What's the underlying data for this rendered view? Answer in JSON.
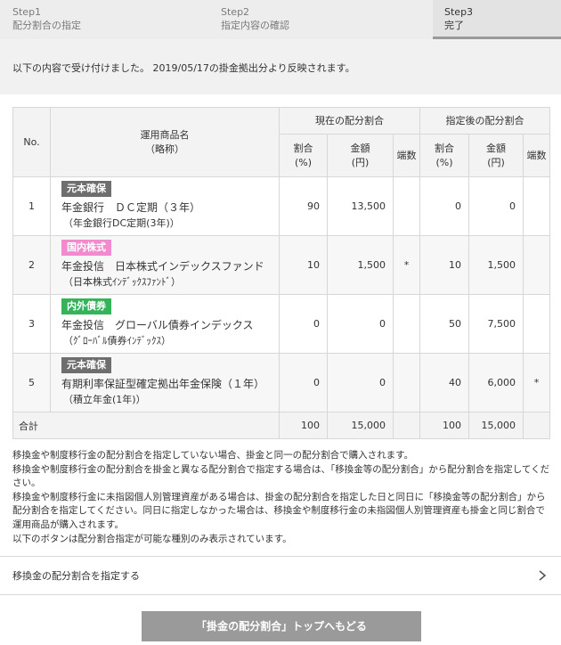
{
  "steps": [
    {
      "num": "Step1",
      "label": "配分割合の指定"
    },
    {
      "num": "Step2",
      "label": "指定内容の確認"
    },
    {
      "num": "Step3",
      "label": "完了"
    }
  ],
  "message": "以下の内容で受け付けました。 2019/05/17の掛金拠出分より反映されます。",
  "table": {
    "headers": {
      "no": "No.",
      "product_line1": "運用商品名",
      "product_line2": "（略称）",
      "current": "現在の配分割合",
      "after": "指定後の配分割合",
      "ratio_line1": "割合",
      "ratio_line2": "(%)",
      "amount_line1": "金額",
      "amount_line2": "(円)",
      "fraction": "端数"
    },
    "rows": [
      {
        "no": "1",
        "badge": "元本確保",
        "badge_color": "#6e6e6e",
        "name": "年金銀行　ＤＣ定期（３年）",
        "abbr": "（年金銀行DC定期(3年)）",
        "cur_ratio": "90",
        "cur_amount": "13,500",
        "cur_frac": "",
        "new_ratio": "0",
        "new_amount": "0",
        "new_frac": ""
      },
      {
        "no": "2",
        "badge": "国内株式",
        "badge_color": "#f28ad0",
        "name": "年金投信　日本株式インデックスファンド",
        "abbr": "（日本株式ｲﾝﾃﾞｯｸｽﾌｧﾝﾄﾞ）",
        "cur_ratio": "10",
        "cur_amount": "1,500",
        "cur_frac": "*",
        "new_ratio": "10",
        "new_amount": "1,500",
        "new_frac": ""
      },
      {
        "no": "3",
        "badge": "内外債券",
        "badge_color": "#35b35b",
        "name": "年金投信　グローバル債券インデックス",
        "abbr": "（ｸﾞﾛｰﾊﾞﾙ債券ｲﾝﾃﾞｯｸｽ）",
        "cur_ratio": "0",
        "cur_amount": "0",
        "cur_frac": "",
        "new_ratio": "50",
        "new_amount": "7,500",
        "new_frac": ""
      },
      {
        "no": "5",
        "badge": "元本確保",
        "badge_color": "#6e6e6e",
        "name": "有期利率保証型確定拠出年金保険（１年）",
        "abbr": "（積立年金(1年)）",
        "cur_ratio": "0",
        "cur_amount": "0",
        "cur_frac": "",
        "new_ratio": "40",
        "new_amount": "6,000",
        "new_frac": "*"
      }
    ],
    "total": {
      "label": "合計",
      "cur_ratio": "100",
      "cur_amount": "15,000",
      "new_ratio": "100",
      "new_amount": "15,000"
    }
  },
  "notes": [
    "移換金や制度移行金の配分割合を指定していない場合、掛金と同一の配分割合で購入されます。",
    "移換金や制度移行金の配分割合を掛金と異なる配分割合で指定する場合は、「移換金等の配分割合」から配分割合を指定してください。",
    "移換金や制度移行金に未指図個人別管理資産がある場合は、掛金の配分割合を指定した日と同日に「移換金等の配分割合」から配分割合を指定してください。同日に指定しなかった場合は、移換金や制度移行金の未指図個人別管理資産も掛金と同じ割合で運用商品が購入されます。",
    "以下のボタンは配分割合指定が可能な種別のみ表示されています。"
  ],
  "link_label": "移換金の配分割合を指定する",
  "back_button": "「掛金の配分割合」トップへもどる",
  "colors": {
    "step_active_bar": "#9a9a9a",
    "button_bg": "#9a9a9a"
  },
  "icons": {
    "link_arrow": "chevron-right-icon"
  }
}
